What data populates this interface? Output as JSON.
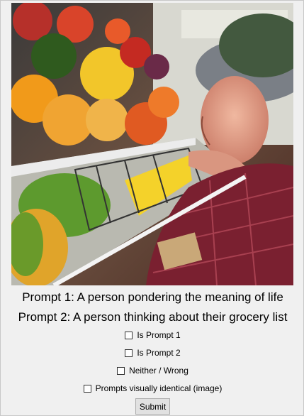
{
  "prompts": {
    "prompt1": "Prompt 1: A person pondering the meaning of life",
    "prompt2": "Prompt 2: A person thinking about their grocery list"
  },
  "options": [
    {
      "label": "Is Prompt 1",
      "checked": false
    },
    {
      "label": "Is Prompt 2",
      "checked": false
    },
    {
      "label": "Neither / Wrong",
      "checked": false
    },
    {
      "label": "Prompts visually identical (image)",
      "checked": false
    }
  ],
  "submit_label": "Submit"
}
